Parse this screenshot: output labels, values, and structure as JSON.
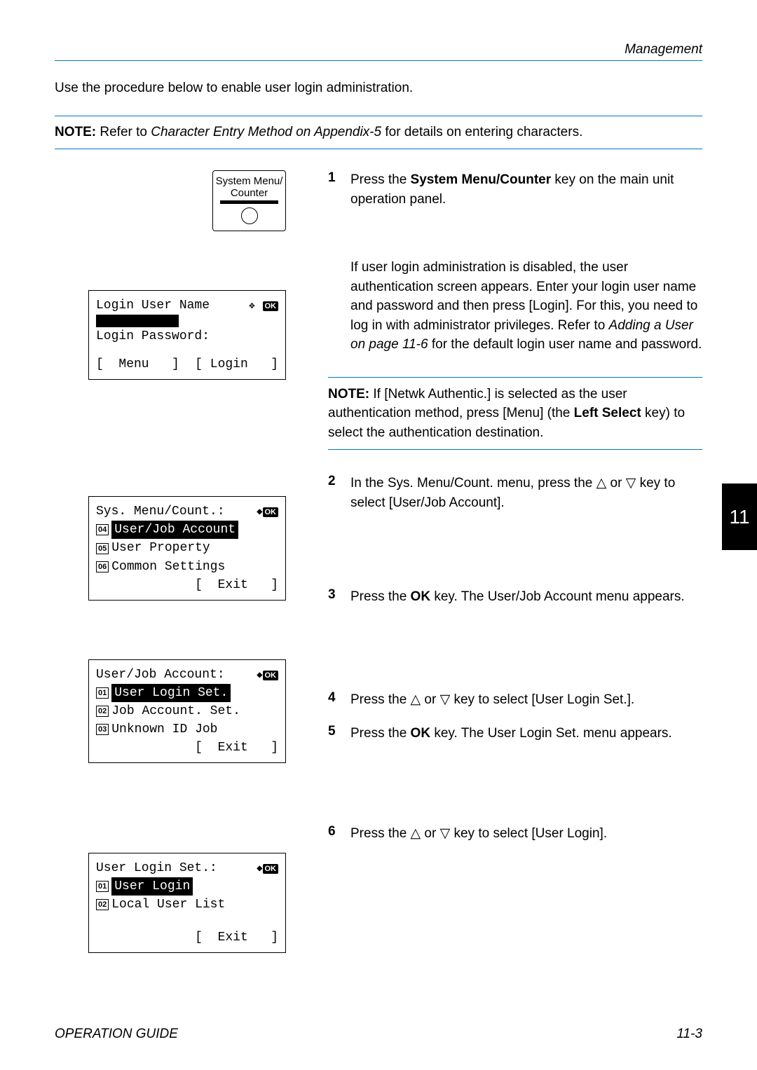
{
  "header": {
    "section": "Management"
  },
  "intro": "Use the procedure below to enable user login administration.",
  "note1": {
    "label": "NOTE:",
    "text_before": " Refer to ",
    "italic": "Character Entry Method on Appendix-5",
    "text_after": " for details on entering characters."
  },
  "sys_button": {
    "line1": "System Menu/",
    "line2": "Counter"
  },
  "lcd_login": {
    "title": "Login User Name",
    "pw_label": "Login Password:",
    "menu": "[  Menu   ]",
    "login": "[ Login   ]"
  },
  "lcd_sys": {
    "title": "Sys. Menu/Count.:",
    "items": [
      {
        "num": "04",
        "label": "User/Job Account",
        "selected": true
      },
      {
        "num": "05",
        "label": "User Property",
        "selected": false
      },
      {
        "num": "06",
        "label": "Common Settings",
        "selected": false
      }
    ],
    "exit": "[  Exit   ]"
  },
  "lcd_user": {
    "title": "User/Job Account:",
    "items": [
      {
        "num": "01",
        "label": "User Login Set.",
        "selected": true
      },
      {
        "num": "02",
        "label": "Job Account. Set.",
        "selected": false
      },
      {
        "num": "03",
        "label": "Unknown ID Job",
        "selected": false
      }
    ],
    "exit": "[  Exit   ]"
  },
  "lcd_loginset": {
    "title": "User Login Set.:",
    "items": [
      {
        "num": "01",
        "label": "User Login",
        "selected": true
      },
      {
        "num": "02",
        "label": "Local User List",
        "selected": false
      }
    ],
    "exit": "[  Exit   ]"
  },
  "steps": {
    "s1": {
      "num": "1",
      "a": "Press the ",
      "b": "System Menu/Counter",
      "c": " key on the main unit operation panel."
    },
    "para_auth": {
      "p1": "If user login administration is disabled, the user authentication screen appears. Enter your login user name and password and then press [Login]. For this, you need to log in with administrator privileges. Refer to ",
      "italic": "Adding a User on page 11-6",
      "p2": " for the default login user name and password."
    },
    "note2": {
      "label": "NOTE:",
      "a": "  If [Netwk Authentic.] is selected as the user authentication method, press [Menu] (the ",
      "b": "Left Select",
      "c": " key) to select the authentication destination."
    },
    "s2": {
      "num": "2",
      "text": "In the Sys. Menu/Count. menu, press the △ or ▽ key to select [User/Job Account]."
    },
    "s3": {
      "num": "3",
      "a": "Press the ",
      "b": "OK",
      "c": " key. The User/Job Account menu appears."
    },
    "s4": {
      "num": "4",
      "text": "Press the △ or ▽ key to select [User Login Set.]."
    },
    "s5": {
      "num": "5",
      "a": "Press the ",
      "b": "OK",
      "c": " key. The User Login Set. menu appears."
    },
    "s6": {
      "num": "6",
      "text": "Press the △ or ▽ key to select [User Login]."
    }
  },
  "side_tab": "11",
  "footer": {
    "left": "OPERATION GUIDE",
    "right": "11-3"
  }
}
